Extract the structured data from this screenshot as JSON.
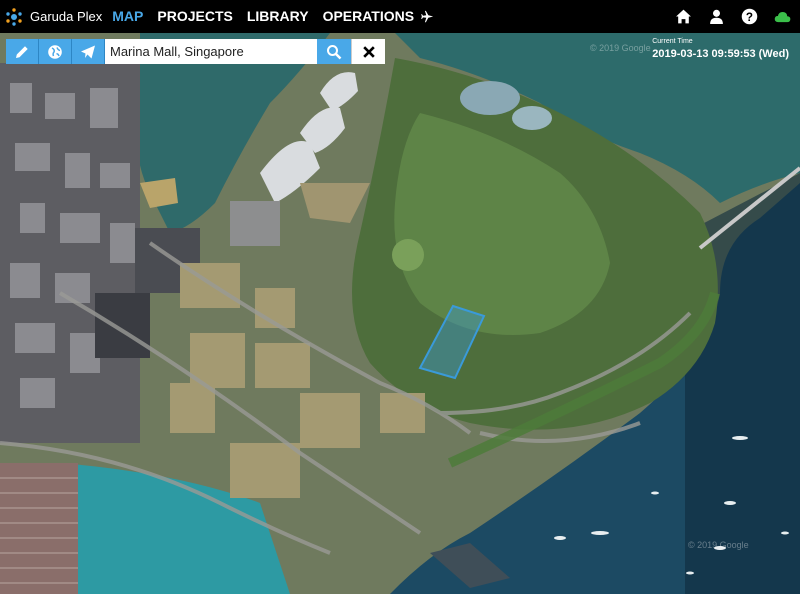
{
  "app": {
    "brand": "Garuda Plex"
  },
  "nav": {
    "tabs": [
      {
        "label": "MAP",
        "active": true
      },
      {
        "label": "PROJECTS",
        "active": false
      },
      {
        "label": "LIBRARY",
        "active": false
      },
      {
        "label": "OPERATIONS",
        "active": false,
        "icon": "airplane-icon"
      }
    ],
    "right_icons": [
      "home-icon",
      "user-icon",
      "help-icon",
      "cloud-icon"
    ]
  },
  "toolbar": {
    "tools": [
      "pencil-icon",
      "globe-icon",
      "paper-plane-icon"
    ],
    "search_value": "Marina Mall, Singapore",
    "search_icon": "search-icon",
    "close_icon": "close-icon"
  },
  "time": {
    "label": "Current Time",
    "value": "2019-03-13 09:59:53 (Wed)"
  },
  "map": {
    "watermark": "© 2019 Google"
  },
  "colors": {
    "accent": "#49a8e8",
    "navbar": "#000000",
    "cloud_status": "#3bbf4a",
    "selection": "#3a9ad9"
  }
}
